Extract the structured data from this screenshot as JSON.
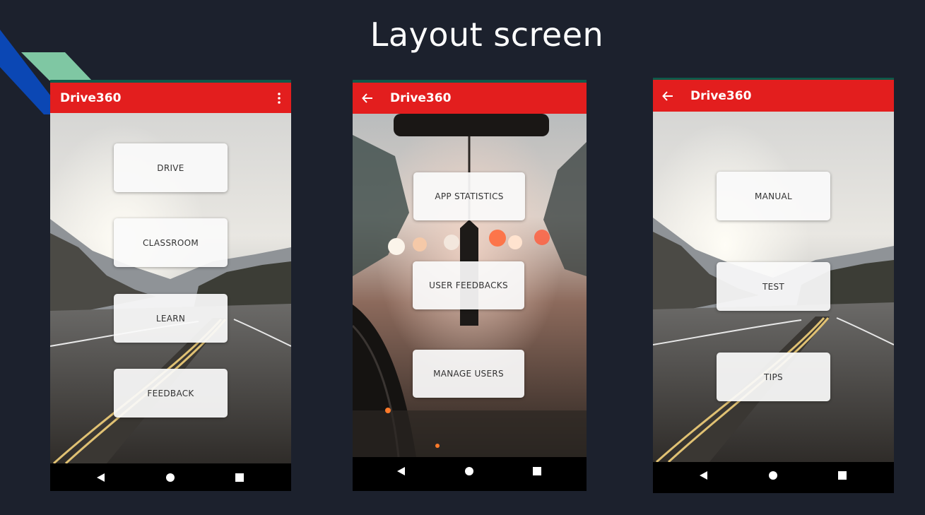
{
  "slide": {
    "title": "Layout screen"
  },
  "phones": [
    {
      "app_title": "Drive360",
      "has_back": false,
      "has_menu": true,
      "buttons": [
        "DRIVE",
        "CLASSROOM",
        "LEARN",
        "FEEDBACK"
      ]
    },
    {
      "app_title": "Drive360",
      "has_back": true,
      "has_menu": false,
      "buttons": [
        "APP STATISTICS",
        "USER FEEDBACKS",
        "MANAGE USERS"
      ]
    },
    {
      "app_title": "Drive360",
      "has_back": true,
      "has_menu": false,
      "buttons": [
        "MANUAL",
        "TEST",
        "TIPS"
      ]
    }
  ],
  "icons": {
    "back": "arrow-back-icon",
    "menu": "more-vert-icon",
    "nav_back": "triangle-back-icon",
    "nav_home": "circle-home-icon",
    "nav_recents": "square-recents-icon"
  },
  "colors": {
    "background": "#1c212d",
    "appbar": "#e31e1e",
    "accent_blue": "#0b47b4",
    "accent_green": "#7fc7a3"
  }
}
